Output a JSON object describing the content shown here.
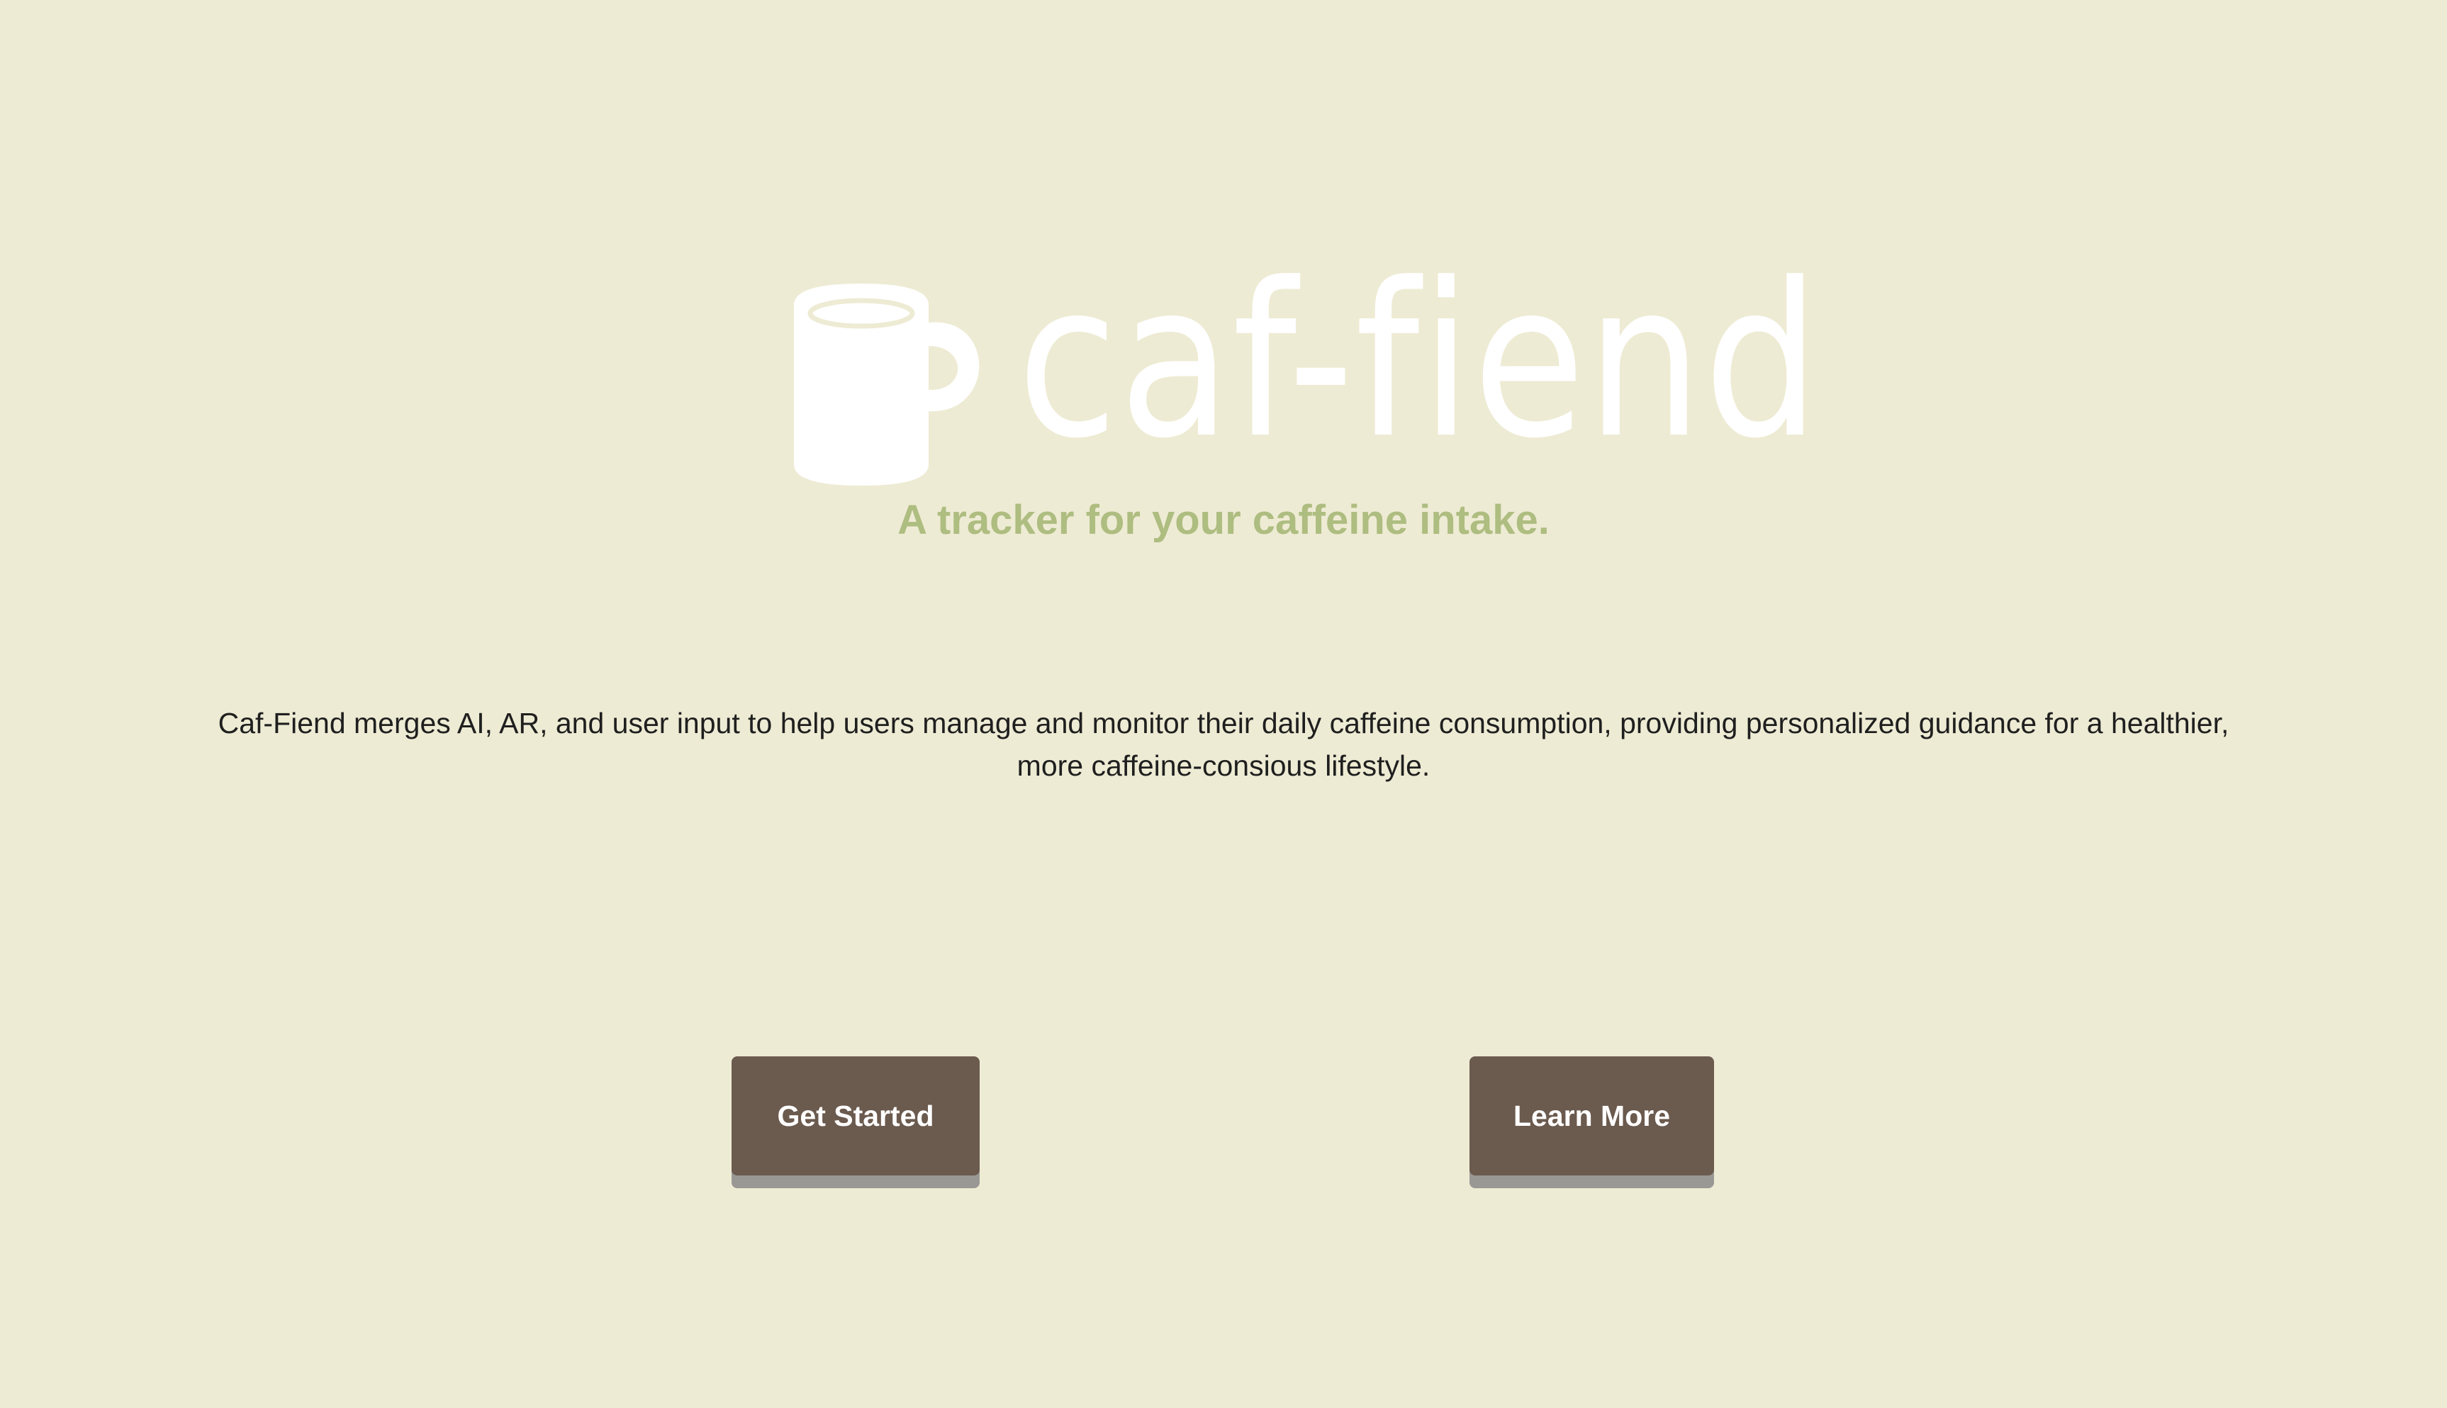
{
  "brand": {
    "name": "caf-fiend",
    "logo_icon": "coffee-mug-icon",
    "logo_color": "#ffffff"
  },
  "hero": {
    "tagline": "A tracker for your caffeine intake.",
    "description": "Caf-Fiend merges AI, AR, and user input to help users manage and monitor their daily caffeine consumption, providing personalized guidance for a healthier, more caffeine-consious lifestyle."
  },
  "actions": {
    "get_started_label": "Get Started",
    "learn_more_label": "Learn More"
  },
  "colors": {
    "background": "#eeebd4",
    "tagline": "#aebd80",
    "button": "#6b5a4e",
    "button_shadow": "#9a9894",
    "text": "#1f1f1f"
  }
}
